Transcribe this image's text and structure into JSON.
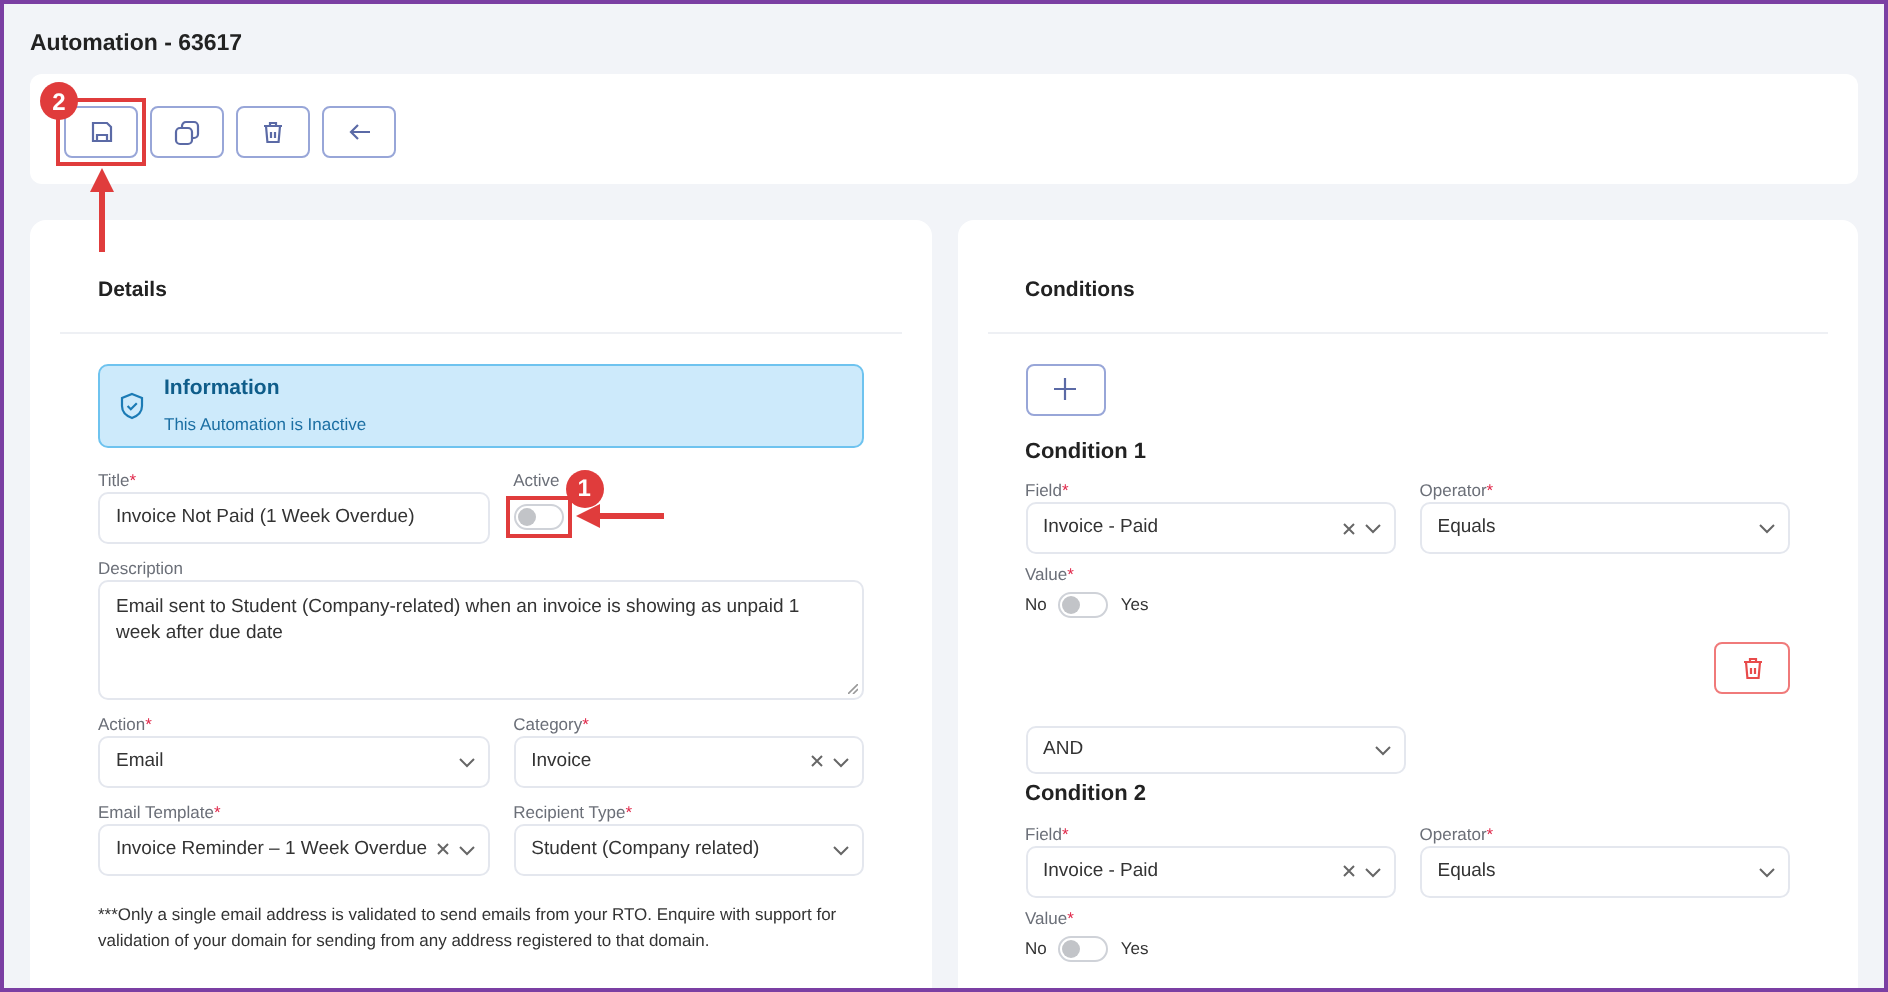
{
  "page_title": "Automation - 63617",
  "toolbar": [
    {
      "kind": "save",
      "callout": {
        "number": "2"
      }
    },
    {
      "kind": "copy"
    },
    {
      "kind": "delete"
    },
    {
      "kind": "back"
    }
  ],
  "details": {
    "heading": "Details",
    "alert": {
      "title": "Information",
      "text": "This Automation is Inactive"
    },
    "fields": [
      {
        "kind": "text",
        "label": "Title",
        "mark": "*",
        "value": "Invoice Not Paid (1 Week Overdue)"
      },
      {
        "kind": "toggle",
        "label": "Active",
        "on": false,
        "callout": {
          "number": "1"
        }
      },
      {
        "kind": "textarea",
        "label": "Description",
        "value": "Email sent to Student (Company-related) when an invoice is showing as unpaid 1 week after due date"
      },
      {
        "kind": "select",
        "label": "Action",
        "mark": "*",
        "value": "Email",
        "clearable": false
      },
      {
        "kind": "select",
        "label": "Category",
        "mark": "*",
        "value": "Invoice",
        "clearable": true
      },
      {
        "kind": "select",
        "label": "Email Template",
        "mark": "*",
        "value": "Invoice Reminder – 1 Week Overdue",
        "clearable": true
      },
      {
        "kind": "select",
        "label": "Recipient Type",
        "mark": "*",
        "value": "Student (Company related)",
        "clearable": false
      }
    ],
    "note": "***Only a single email address is validated to send emails from your RTO. Enquire with support for validation of your domain for sending from any address registered to that domain."
  },
  "conditions": {
    "heading": "Conditions",
    "items": [
      {
        "title": "Condition 1",
        "field": {
          "label": "Field",
          "mark": "*",
          "value": "Invoice - Paid",
          "clearable": true
        },
        "operator": {
          "label": "Operator",
          "mark": "*",
          "value": "Equals",
          "clearable": false
        },
        "value": {
          "label": "Value",
          "mark": "*",
          "off_label": "No",
          "on_label": "Yes",
          "on": false
        },
        "deletable": true
      },
      {
        "connector": "AND",
        "title": "Condition 2",
        "field": {
          "label": "Field",
          "mark": "*",
          "value": "Invoice - Paid",
          "clearable": true
        },
        "operator": {
          "label": "Operator",
          "mark": "*",
          "value": "Equals",
          "clearable": false
        },
        "value": {
          "label": "Value",
          "mark": "*",
          "off_label": "No",
          "on_label": "Yes",
          "on": false
        },
        "deletable": false
      }
    ]
  }
}
